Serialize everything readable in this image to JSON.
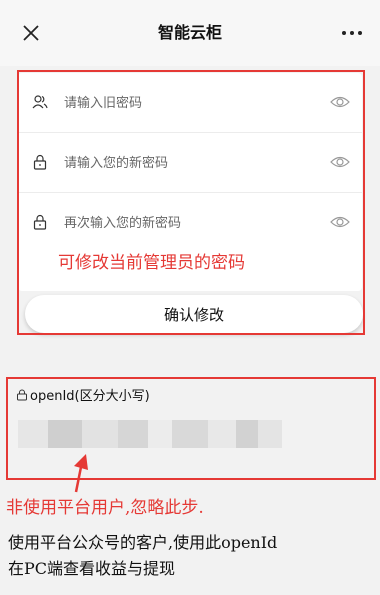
{
  "navbar": {
    "title": "智能云柜",
    "close_icon": "close-icon",
    "more_icon": "more-icon"
  },
  "form": {
    "old_password": {
      "placeholder": "请输入旧密码",
      "icon": "users-icon",
      "toggle_icon": "eye-icon"
    },
    "new_password": {
      "placeholder": "请输入您的新密码",
      "icon": "lock-icon",
      "toggle_icon": "eye-icon"
    },
    "confirm_password": {
      "placeholder": "再次输入您的新密码",
      "icon": "lock-icon",
      "toggle_icon": "eye-icon"
    },
    "submit_label": "确认修改"
  },
  "annotations": {
    "password_note": "可修改当前管理员的密码",
    "non_platform_note": "非使用平台用户,忽略此步."
  },
  "openid": {
    "label": "openId(区分大小写)"
  },
  "info": {
    "line1": "使用平台公众号的客户,使用此openId",
    "line2": "在PC端查看收益与提现"
  },
  "colors": {
    "annotation_red": "#e53935",
    "background": "#f2f2f2"
  }
}
